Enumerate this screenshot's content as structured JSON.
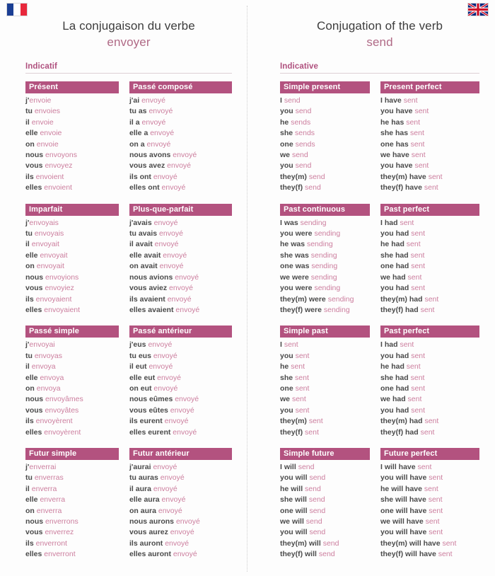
{
  "flags": {
    "left": "french-flag",
    "right": "uk-flag"
  },
  "french": {
    "title_line1": "La conjugaison du verbe",
    "verb": "envoyer",
    "mood": "Indicatif",
    "tenses": [
      {
        "name": "Présent",
        "rows": [
          {
            "pron": "j'",
            "aux": "",
            "verb": "envoie"
          },
          {
            "pron": "tu",
            "aux": "",
            "verb": "envoies"
          },
          {
            "pron": "il",
            "aux": "",
            "verb": "envoie"
          },
          {
            "pron": "elle",
            "aux": "",
            "verb": "envoie"
          },
          {
            "pron": "on",
            "aux": "",
            "verb": "envoie"
          },
          {
            "pron": "nous",
            "aux": "",
            "verb": "envoyons"
          },
          {
            "pron": "vous",
            "aux": "",
            "verb": "envoyez"
          },
          {
            "pron": "ils",
            "aux": "",
            "verb": "envoient"
          },
          {
            "pron": "elles",
            "aux": "",
            "verb": "envoient"
          }
        ]
      },
      {
        "name": "Passé composé",
        "rows": [
          {
            "pron": "j'ai",
            "aux": "",
            "verb": "envoyé"
          },
          {
            "pron": "tu",
            "aux": "as",
            "verb": "envoyé"
          },
          {
            "pron": "il",
            "aux": "a",
            "verb": "envoyé"
          },
          {
            "pron": "elle",
            "aux": "a",
            "verb": "envoyé"
          },
          {
            "pron": "on",
            "aux": "a",
            "verb": "envoyé"
          },
          {
            "pron": "nous",
            "aux": "avons",
            "verb": "envoyé"
          },
          {
            "pron": "vous",
            "aux": "avez",
            "verb": "envoyé"
          },
          {
            "pron": "ils",
            "aux": "ont",
            "verb": "envoyé"
          },
          {
            "pron": "elles",
            "aux": "ont",
            "verb": "envoyé"
          }
        ]
      },
      {
        "name": "Imparfait",
        "rows": [
          {
            "pron": "j'",
            "aux": "",
            "verb": "envoyais"
          },
          {
            "pron": "tu",
            "aux": "",
            "verb": "envoyais"
          },
          {
            "pron": "il",
            "aux": "",
            "verb": "envoyait"
          },
          {
            "pron": "elle",
            "aux": "",
            "verb": "envoyait"
          },
          {
            "pron": "on",
            "aux": "",
            "verb": "envoyait"
          },
          {
            "pron": "nous",
            "aux": "",
            "verb": "envoyions"
          },
          {
            "pron": "vous",
            "aux": "",
            "verb": "envoyiez"
          },
          {
            "pron": "ils",
            "aux": "",
            "verb": "envoyaient"
          },
          {
            "pron": "elles",
            "aux": "",
            "verb": "envoyaient"
          }
        ]
      },
      {
        "name": "Plus-que-parfait",
        "rows": [
          {
            "pron": "j'avais",
            "aux": "",
            "verb": "envoyé"
          },
          {
            "pron": "tu",
            "aux": "avais",
            "verb": "envoyé"
          },
          {
            "pron": "il",
            "aux": "avait",
            "verb": "envoyé"
          },
          {
            "pron": "elle",
            "aux": "avait",
            "verb": "envoyé"
          },
          {
            "pron": "on",
            "aux": "avait",
            "verb": "envoyé"
          },
          {
            "pron": "nous",
            "aux": "avions",
            "verb": "envoyé"
          },
          {
            "pron": "vous",
            "aux": "aviez",
            "verb": "envoyé"
          },
          {
            "pron": "ils",
            "aux": "avaient",
            "verb": "envoyé"
          },
          {
            "pron": "elles",
            "aux": "avaient",
            "verb": "envoyé"
          }
        ]
      },
      {
        "name": "Passé simple",
        "rows": [
          {
            "pron": "j'",
            "aux": "",
            "verb": "envoyai"
          },
          {
            "pron": "tu",
            "aux": "",
            "verb": "envoyas"
          },
          {
            "pron": "il",
            "aux": "",
            "verb": "envoya"
          },
          {
            "pron": "elle",
            "aux": "",
            "verb": "envoya"
          },
          {
            "pron": "on",
            "aux": "",
            "verb": "envoya"
          },
          {
            "pron": "nous",
            "aux": "",
            "verb": "envoyâmes"
          },
          {
            "pron": "vous",
            "aux": "",
            "verb": "envoyâtes"
          },
          {
            "pron": "ils",
            "aux": "",
            "verb": "envoyèrent"
          },
          {
            "pron": "elles",
            "aux": "",
            "verb": "envoyèrent"
          }
        ]
      },
      {
        "name": "Passé antérieur",
        "rows": [
          {
            "pron": "j'eus",
            "aux": "",
            "verb": "envoyé"
          },
          {
            "pron": "tu",
            "aux": "eus",
            "verb": "envoyé"
          },
          {
            "pron": "il",
            "aux": "eut",
            "verb": "envoyé"
          },
          {
            "pron": "elle",
            "aux": "eut",
            "verb": "envoyé"
          },
          {
            "pron": "on",
            "aux": "eut",
            "verb": "envoyé"
          },
          {
            "pron": "nous",
            "aux": "eûmes",
            "verb": "envoyé"
          },
          {
            "pron": "vous",
            "aux": "eûtes",
            "verb": "envoyé"
          },
          {
            "pron": "ils",
            "aux": "eurent",
            "verb": "envoyé"
          },
          {
            "pron": "elles",
            "aux": "eurent",
            "verb": "envoyé"
          }
        ]
      },
      {
        "name": "Futur simple",
        "rows": [
          {
            "pron": "j'",
            "aux": "",
            "verb": "enverrai"
          },
          {
            "pron": "tu",
            "aux": "",
            "verb": "enverras"
          },
          {
            "pron": "il",
            "aux": "",
            "verb": "enverra"
          },
          {
            "pron": "elle",
            "aux": "",
            "verb": "enverra"
          },
          {
            "pron": "on",
            "aux": "",
            "verb": "enverra"
          },
          {
            "pron": "nous",
            "aux": "",
            "verb": "enverrons"
          },
          {
            "pron": "vous",
            "aux": "",
            "verb": "enverrez"
          },
          {
            "pron": "ils",
            "aux": "",
            "verb": "enverront"
          },
          {
            "pron": "elles",
            "aux": "",
            "verb": "enverront"
          }
        ]
      },
      {
        "name": "Futur antérieur",
        "rows": [
          {
            "pron": "j'aurai",
            "aux": "",
            "verb": "envoyé"
          },
          {
            "pron": "tu",
            "aux": "auras",
            "verb": "envoyé"
          },
          {
            "pron": "il",
            "aux": "aura",
            "verb": "envoyé"
          },
          {
            "pron": "elle",
            "aux": "aura",
            "verb": "envoyé"
          },
          {
            "pron": "on",
            "aux": "aura",
            "verb": "envoyé"
          },
          {
            "pron": "nous",
            "aux": "aurons",
            "verb": "envoyé"
          },
          {
            "pron": "vous",
            "aux": "aurez",
            "verb": "envoyé"
          },
          {
            "pron": "ils",
            "aux": "auront",
            "verb": "envoyé"
          },
          {
            "pron": "elles",
            "aux": "auront",
            "verb": "envoyé"
          }
        ]
      }
    ]
  },
  "english": {
    "title_line1": "Conjugation of the verb",
    "verb": "send",
    "mood": "Indicative",
    "tenses": [
      {
        "name": "Simple present",
        "rows": [
          {
            "pron": "I",
            "aux": "",
            "verb": "send"
          },
          {
            "pron": "you",
            "aux": "",
            "verb": "send"
          },
          {
            "pron": "he",
            "aux": "",
            "verb": "sends"
          },
          {
            "pron": "she",
            "aux": "",
            "verb": "sends"
          },
          {
            "pron": "one",
            "aux": "",
            "verb": "sends"
          },
          {
            "pron": "we",
            "aux": "",
            "verb": "send"
          },
          {
            "pron": "you",
            "aux": "",
            "verb": "send"
          },
          {
            "pron": "they(m)",
            "aux": "",
            "verb": "send"
          },
          {
            "pron": "they(f)",
            "aux": "",
            "verb": "send"
          }
        ]
      },
      {
        "name": "Present perfect",
        "rows": [
          {
            "pron": "I",
            "aux": "have",
            "verb": "sent"
          },
          {
            "pron": "you",
            "aux": "have",
            "verb": "sent"
          },
          {
            "pron": "he",
            "aux": "has",
            "verb": "sent"
          },
          {
            "pron": "she",
            "aux": "has",
            "verb": "sent"
          },
          {
            "pron": "one",
            "aux": "has",
            "verb": "sent"
          },
          {
            "pron": "we",
            "aux": "have",
            "verb": "sent"
          },
          {
            "pron": "you",
            "aux": "have",
            "verb": "sent"
          },
          {
            "pron": "they(m)",
            "aux": "have",
            "verb": "sent"
          },
          {
            "pron": "they(f)",
            "aux": "have",
            "verb": "sent"
          }
        ]
      },
      {
        "name": "Past continuous",
        "rows": [
          {
            "pron": "I",
            "aux": "was",
            "verb": "sending"
          },
          {
            "pron": "you",
            "aux": "were",
            "verb": "sending"
          },
          {
            "pron": "he",
            "aux": "was",
            "verb": "sending"
          },
          {
            "pron": "she",
            "aux": "was",
            "verb": "sending"
          },
          {
            "pron": "one",
            "aux": "was",
            "verb": "sending"
          },
          {
            "pron": "we",
            "aux": "were",
            "verb": "sending"
          },
          {
            "pron": "you",
            "aux": "were",
            "verb": "sending"
          },
          {
            "pron": "they(m)",
            "aux": "were",
            "verb": "sending"
          },
          {
            "pron": "they(f)",
            "aux": "were",
            "verb": "sending"
          }
        ]
      },
      {
        "name": "Past perfect",
        "rows": [
          {
            "pron": "I",
            "aux": "had",
            "verb": "sent"
          },
          {
            "pron": "you",
            "aux": "had",
            "verb": "sent"
          },
          {
            "pron": "he",
            "aux": "had",
            "verb": "sent"
          },
          {
            "pron": "she",
            "aux": "had",
            "verb": "sent"
          },
          {
            "pron": "one",
            "aux": "had",
            "verb": "sent"
          },
          {
            "pron": "we",
            "aux": "had",
            "verb": "sent"
          },
          {
            "pron": "you",
            "aux": "had",
            "verb": "sent"
          },
          {
            "pron": "they(m)",
            "aux": "had",
            "verb": "sent"
          },
          {
            "pron": "they(f)",
            "aux": "had",
            "verb": "sent"
          }
        ]
      },
      {
        "name": "Simple past",
        "rows": [
          {
            "pron": "I",
            "aux": "",
            "verb": "sent"
          },
          {
            "pron": "you",
            "aux": "",
            "verb": "sent"
          },
          {
            "pron": "he",
            "aux": "",
            "verb": "sent"
          },
          {
            "pron": "she",
            "aux": "",
            "verb": "sent"
          },
          {
            "pron": "one",
            "aux": "",
            "verb": "sent"
          },
          {
            "pron": "we",
            "aux": "",
            "verb": "sent"
          },
          {
            "pron": "you",
            "aux": "",
            "verb": "sent"
          },
          {
            "pron": "they(m)",
            "aux": "",
            "verb": "sent"
          },
          {
            "pron": "they(f)",
            "aux": "",
            "verb": "sent"
          }
        ]
      },
      {
        "name": "Past perfect",
        "rows": [
          {
            "pron": "I",
            "aux": "had",
            "verb": "sent"
          },
          {
            "pron": "you",
            "aux": "had",
            "verb": "sent"
          },
          {
            "pron": "he",
            "aux": "had",
            "verb": "sent"
          },
          {
            "pron": "she",
            "aux": "had",
            "verb": "sent"
          },
          {
            "pron": "one",
            "aux": "had",
            "verb": "sent"
          },
          {
            "pron": "we",
            "aux": "had",
            "verb": "sent"
          },
          {
            "pron": "you",
            "aux": "had",
            "verb": "sent"
          },
          {
            "pron": "they(m)",
            "aux": "had",
            "verb": "sent"
          },
          {
            "pron": "they(f)",
            "aux": "had",
            "verb": "sent"
          }
        ]
      },
      {
        "name": "Simple future",
        "rows": [
          {
            "pron": "I",
            "aux": "will",
            "verb": "send"
          },
          {
            "pron": "you",
            "aux": "will",
            "verb": "send"
          },
          {
            "pron": "he",
            "aux": "will",
            "verb": "send"
          },
          {
            "pron": "she",
            "aux": "will",
            "verb": "send"
          },
          {
            "pron": "one",
            "aux": "will",
            "verb": "send"
          },
          {
            "pron": "we",
            "aux": "will",
            "verb": "send"
          },
          {
            "pron": "you",
            "aux": "will",
            "verb": "send"
          },
          {
            "pron": "they(m)",
            "aux": "will",
            "verb": "send"
          },
          {
            "pron": "they(f)",
            "aux": "will",
            "verb": "send"
          }
        ]
      },
      {
        "name": "Future perfect",
        "rows": [
          {
            "pron": "I",
            "aux": "will have",
            "verb": "sent"
          },
          {
            "pron": "you",
            "aux": "will have",
            "verb": "sent"
          },
          {
            "pron": "he",
            "aux": "will have",
            "verb": "sent"
          },
          {
            "pron": "she",
            "aux": "will have",
            "verb": "sent"
          },
          {
            "pron": "one",
            "aux": "will have",
            "verb": "sent"
          },
          {
            "pron": "we",
            "aux": "will have",
            "verb": "sent"
          },
          {
            "pron": "you",
            "aux": "will have",
            "verb": "sent"
          },
          {
            "pron": "they(m)",
            "aux": "will have",
            "verb": "sent"
          },
          {
            "pron": "they(f)",
            "aux": "will have",
            "verb": "sent"
          }
        ]
      }
    ]
  },
  "colors": {
    "header_bar": "#b3527f",
    "verb_text": "#cc7e9e",
    "mood_label": "#b0517f",
    "title_verb": "#b06a86",
    "pronoun": "#4a4a4a"
  }
}
